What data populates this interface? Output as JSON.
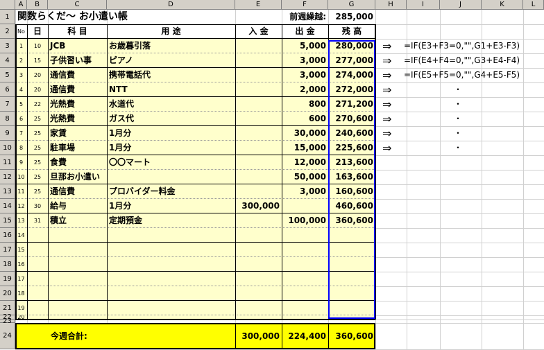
{
  "columns": [
    "A",
    "B",
    "C",
    "D",
    "E",
    "F",
    "G",
    "H",
    "I",
    "J",
    "K",
    "L"
  ],
  "title": "関数らくだ〜 お小遣い帳",
  "carry_label": "前週繰越:",
  "carry_value": "285,000",
  "headers": {
    "no": "No",
    "day": "日",
    "item": "科 目",
    "purpose": "用 途",
    "income": "入 金",
    "expense": "出 金",
    "balance": "残 高"
  },
  "rows": [
    {
      "no": "1",
      "day": "10",
      "item": "JCB",
      "purpose": "お歳暮引落",
      "income": "",
      "expense": "5,000",
      "balance": "280,000"
    },
    {
      "no": "2",
      "day": "15",
      "item": "子供習い事",
      "purpose": "ピアノ",
      "income": "",
      "expense": "3,000",
      "balance": "277,000"
    },
    {
      "no": "3",
      "day": "20",
      "item": "通信費",
      "purpose": "携帯電話代",
      "income": "",
      "expense": "3,000",
      "balance": "274,000"
    },
    {
      "no": "4",
      "day": "20",
      "item": "通信費",
      "purpose": "NTT",
      "income": "",
      "expense": "2,000",
      "balance": "272,000"
    },
    {
      "no": "5",
      "day": "22",
      "item": "光熱費",
      "purpose": "水道代",
      "income": "",
      "expense": "800",
      "balance": "271,200"
    },
    {
      "no": "6",
      "day": "25",
      "item": "光熱費",
      "purpose": "ガス代",
      "income": "",
      "expense": "600",
      "balance": "270,600"
    },
    {
      "no": "7",
      "day": "25",
      "item": "家賃",
      "purpose": "1月分",
      "income": "",
      "expense": "30,000",
      "balance": "240,600"
    },
    {
      "no": "8",
      "day": "25",
      "item": "駐車場",
      "purpose": "1月分",
      "income": "",
      "expense": "15,000",
      "balance": "225,600"
    },
    {
      "no": "9",
      "day": "25",
      "item": "食費",
      "purpose": "〇〇マート",
      "income": "",
      "expense": "12,000",
      "balance": "213,600"
    },
    {
      "no": "10",
      "day": "25",
      "item": "旦那お小遣い",
      "purpose": "",
      "income": "",
      "expense": "50,000",
      "balance": "163,600"
    },
    {
      "no": "11",
      "day": "25",
      "item": "通信費",
      "purpose": "プロバイダー料金",
      "income": "",
      "expense": "3,000",
      "balance": "160,600"
    },
    {
      "no": "12",
      "day": "30",
      "item": "給与",
      "purpose": "1月分",
      "income": "300,000",
      "expense": "",
      "balance": "460,600"
    },
    {
      "no": "13",
      "day": "31",
      "item": "積立",
      "purpose": "定期預金",
      "income": "",
      "expense": "100,000",
      "balance": "360,600"
    },
    {
      "no": "14",
      "day": "",
      "item": "",
      "purpose": "",
      "income": "",
      "expense": "",
      "balance": ""
    },
    {
      "no": "15",
      "day": "",
      "item": "",
      "purpose": "",
      "income": "",
      "expense": "",
      "balance": ""
    },
    {
      "no": "16",
      "day": "",
      "item": "",
      "purpose": "",
      "income": "",
      "expense": "",
      "balance": ""
    },
    {
      "no": "17",
      "day": "",
      "item": "",
      "purpose": "",
      "income": "",
      "expense": "",
      "balance": ""
    },
    {
      "no": "18",
      "day": "",
      "item": "",
      "purpose": "",
      "income": "",
      "expense": "",
      "balance": ""
    },
    {
      "no": "19",
      "day": "",
      "item": "",
      "purpose": "",
      "income": "",
      "expense": "",
      "balance": ""
    },
    {
      "no": "20",
      "day": "",
      "item": "",
      "purpose": "",
      "income": "",
      "expense": "",
      "balance": ""
    }
  ],
  "total_label": "今週合計:",
  "total_income": "300,000",
  "total_expense": "224,400",
  "total_balance": "360,600",
  "formulas": [
    "=IF(E3+F3=0,\"\",G1+E3-F3)",
    "=IF(E4+F4=0,\"\",G3+E4-F4)",
    "=IF(E5+F5=0,\"\",G4+E5-F5)"
  ],
  "arrow": "⇒",
  "dot": "・",
  "row_numbers": [
    "1",
    "2",
    "3",
    "4",
    "5",
    "6",
    "7",
    "8",
    "9",
    "10",
    "11",
    "12",
    "13",
    "14",
    "15",
    "16",
    "17",
    "18",
    "19",
    "20",
    "21",
    "22",
    "23",
    "24"
  ]
}
